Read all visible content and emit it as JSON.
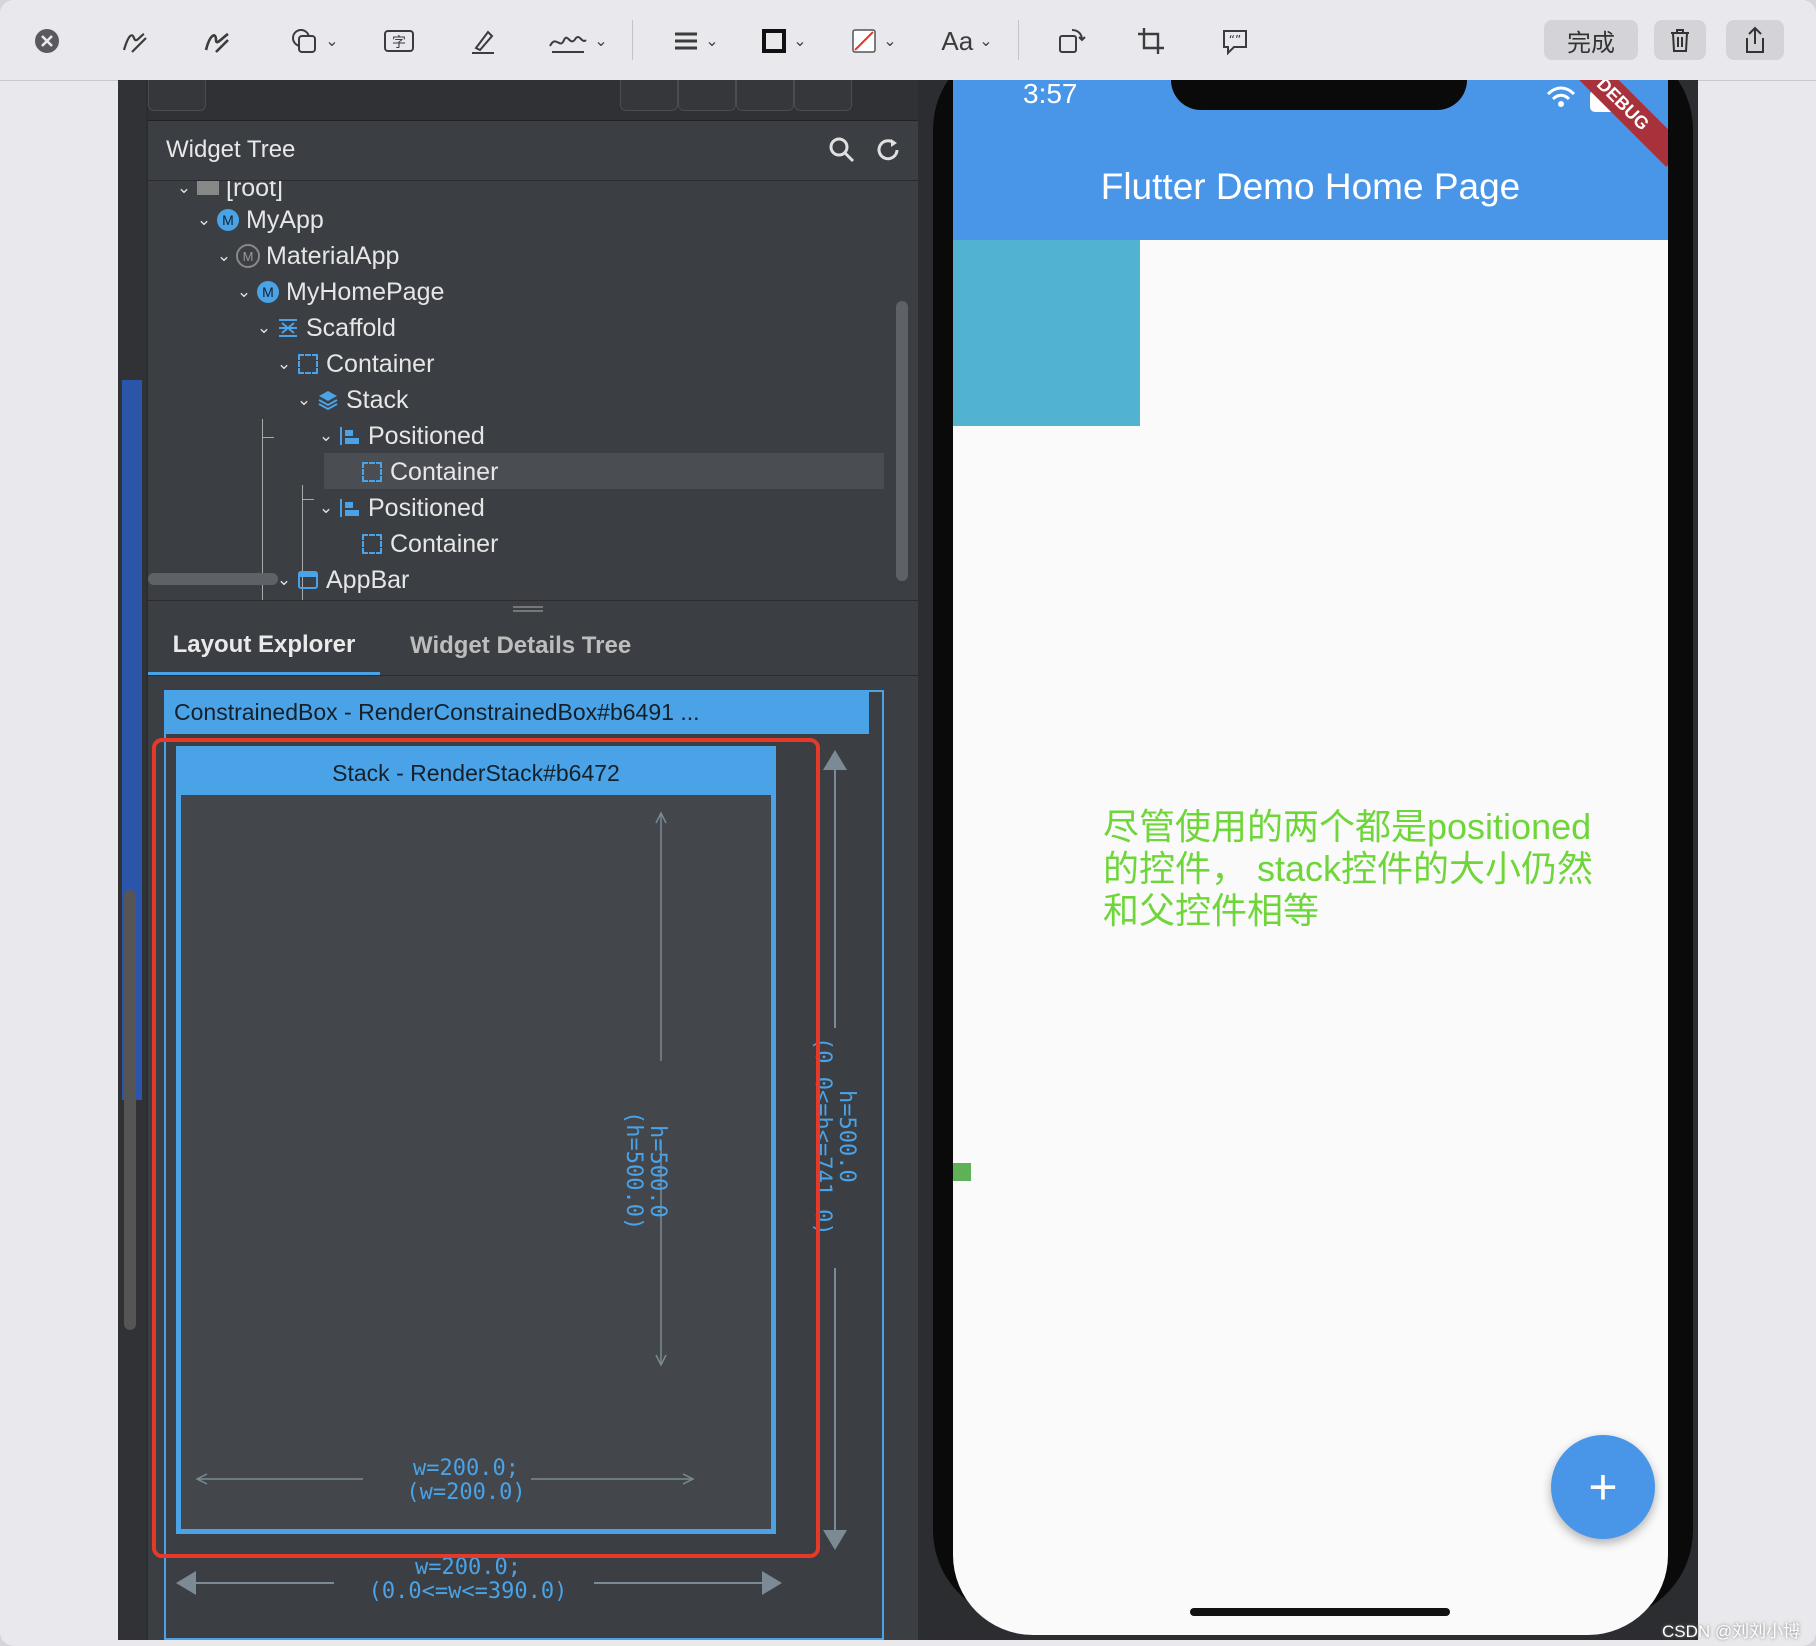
{
  "toolbar": {
    "done_label": "完成",
    "font_label": "Aa"
  },
  "devtools": {
    "widget_tree_title": "Widget Tree",
    "tree": [
      {
        "label": "[root]"
      },
      {
        "label": "MyApp",
        "icon": "m-badge-icon"
      },
      {
        "label": "MaterialApp",
        "icon": "m-grey-badge-icon"
      },
      {
        "label": "MyHomePage",
        "icon": "m-badge-icon"
      },
      {
        "label": "Scaffold",
        "icon": "scaffold-icon"
      },
      {
        "label": "Container",
        "icon": "container-icon"
      },
      {
        "label": "Stack",
        "icon": "stack-icon",
        "selected": true
      },
      {
        "label": "Positioned",
        "icon": "positioned-icon"
      },
      {
        "label": "Container",
        "icon": "container-icon"
      },
      {
        "label": "Positioned",
        "icon": "positioned-icon"
      },
      {
        "label": "Container",
        "icon": "container-icon"
      },
      {
        "label": "AppBar",
        "icon": "appbar-icon"
      }
    ],
    "tabs": [
      "Layout Explorer",
      "Widget Details Tree"
    ],
    "constrained_box_label": "ConstrainedBox - RenderConstrainedBox#b6491 ...",
    "stack_label": "Stack - RenderStack#b6472",
    "inner_h_line1": "h=500.0",
    "inner_h_line2": "(h=500.0)",
    "inner_w_line1": "w=200.0;",
    "inner_w_line2": "(w=200.0)",
    "outer_h_line1": "h=500.0",
    "outer_h_line2": "(0.0<=h<=741.0)",
    "outer_w_line1": "w=200.0;",
    "outer_w_line2": "(0.0<=w<=390.0)"
  },
  "phone": {
    "time": "3:57",
    "app_title": "Flutter Demo Home Page",
    "debug_banner": "DEBUG",
    "annotation": "尽管使用的两个都是positioned的控件， stack控件的大小仍然和父控件相等",
    "fab_label": "+"
  },
  "watermark": "CSDN @刘刘小博",
  "colors": {
    "accent": "#4aa3e6",
    "appbar": "#4996e8",
    "annotation": "#6fd63a",
    "highlight_box": "#e53a2a"
  }
}
